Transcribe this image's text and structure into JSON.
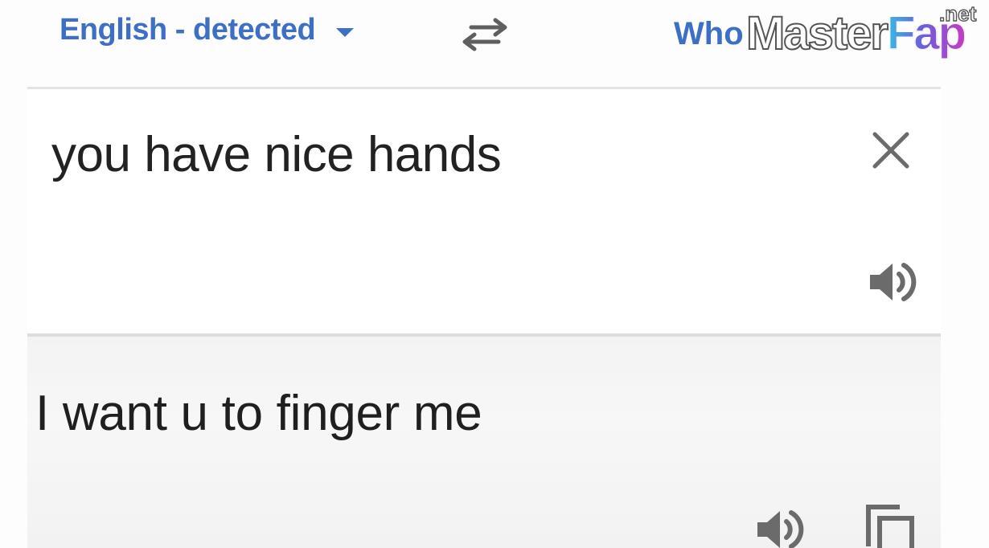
{
  "language_bar": {
    "source_language": "English - detected",
    "target_language_partial": "Who"
  },
  "source": {
    "text": "you have nice hands"
  },
  "result": {
    "text": "I want u to finger me"
  },
  "watermark": {
    "part1": "Master",
    "part2": "Fap",
    "suffix": ".net"
  },
  "icons": {
    "dropdown": "chevron-down-icon",
    "swap": "swap-icon",
    "clear": "close-icon",
    "speaker": "speaker-icon",
    "copy": "copy-icon"
  },
  "colors": {
    "accent": "#3d6fc5",
    "text": "#222222",
    "icon": "#6b6b6b",
    "divider": "#e4e4e4",
    "result_background": "#f4f4f4"
  }
}
